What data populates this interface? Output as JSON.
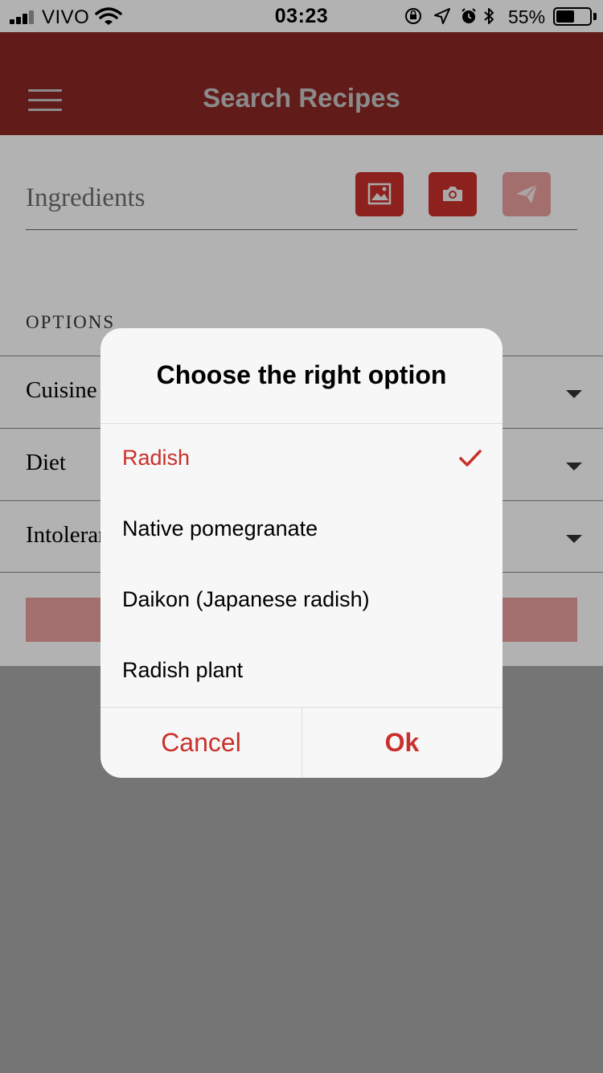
{
  "status_bar": {
    "carrier": "VIVO",
    "time": "03:23",
    "battery_percent": "55%",
    "battery_level": 0.55,
    "icons": [
      "signal-icon",
      "wifi-icon",
      "rotation-lock-icon",
      "location-icon",
      "alarm-icon",
      "bluetooth-icon",
      "battery-icon"
    ]
  },
  "app_bar": {
    "title": "Search Recipes",
    "menu_icon": "hamburger-menu-icon"
  },
  "search": {
    "placeholder": "Ingredients",
    "buttons": [
      {
        "name": "gallery-button",
        "icon": "image-icon",
        "enabled": true
      },
      {
        "name": "camera-button",
        "icon": "camera-icon",
        "enabled": true
      },
      {
        "name": "send-button",
        "icon": "paper-plane-icon",
        "enabled": false
      }
    ]
  },
  "options": {
    "heading": "OPTIONS",
    "rows": [
      {
        "label": "Cuisine"
      },
      {
        "label": "Diet"
      },
      {
        "label": "Intolerances"
      }
    ]
  },
  "colors": {
    "app_bar": "#8b2824",
    "accent": "#c9302c",
    "disabled_accent": "#e9a09e"
  },
  "dialog": {
    "title": "Choose the right option",
    "choices": [
      {
        "label": "Radish",
        "selected": true
      },
      {
        "label": "Native pomegranate",
        "selected": false
      },
      {
        "label": "Daikon (Japanese radish)",
        "selected": false
      },
      {
        "label": "Radish plant",
        "selected": false
      }
    ],
    "cancel_label": "Cancel",
    "ok_label": "Ok"
  }
}
